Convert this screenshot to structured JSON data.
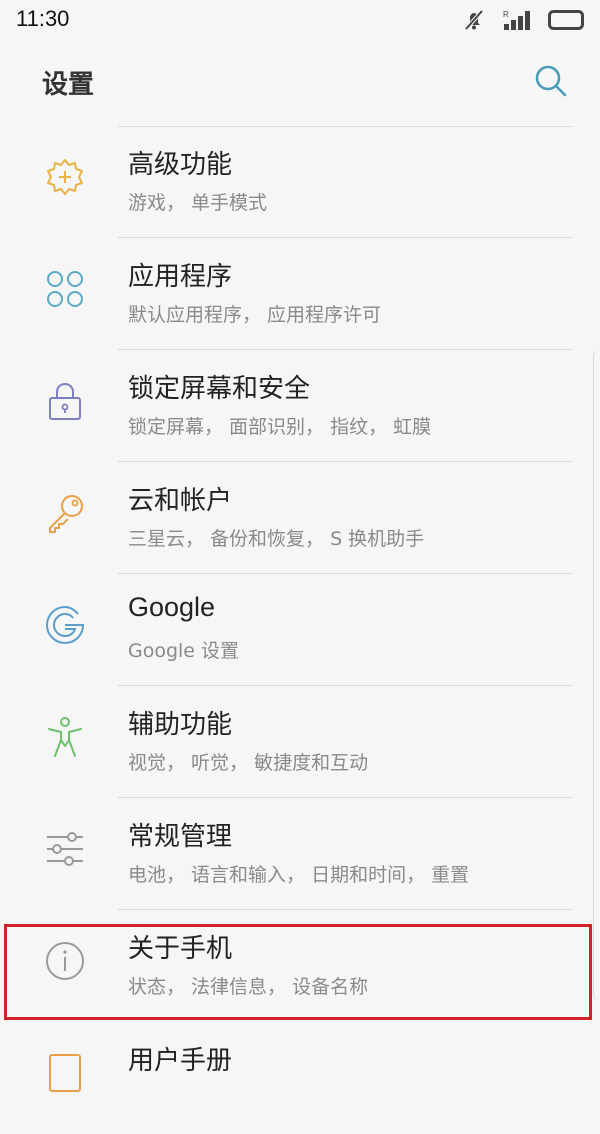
{
  "status_bar": {
    "time": "11:30"
  },
  "header": {
    "title": "设置"
  },
  "settings": [
    {
      "title": "高级功能",
      "subtitle": "游戏， 单手模式",
      "icon": "gear-plus-icon",
      "color": "#e8b347"
    },
    {
      "title": "应用程序",
      "subtitle": "默认应用程序， 应用程序许可",
      "icon": "apps-grid-icon",
      "color": "#5aa9c8"
    },
    {
      "title": "锁定屏幕和安全",
      "subtitle": "锁定屏幕， 面部识别， 指纹， 虹膜",
      "icon": "lock-icon",
      "color": "#7c7fbf"
    },
    {
      "title": "云和帐户",
      "subtitle": "三星云， 备份和恢复， S 换机助手",
      "icon": "key-icon",
      "color": "#e8a04a"
    },
    {
      "title": "Google",
      "subtitle": "Google 设置",
      "icon": "google-icon",
      "color": "#5b9ec9"
    },
    {
      "title": "辅助功能",
      "subtitle": "视觉， 听觉， 敏捷度和互动",
      "icon": "accessibility-icon",
      "color": "#6cbf6c"
    },
    {
      "title": "常规管理",
      "subtitle": "电池， 语言和输入， 日期和时间， 重置",
      "icon": "sliders-icon",
      "color": "#9a9a9a"
    },
    {
      "title": "关于手机",
      "subtitle": "状态， 法律信息， 设备名称",
      "icon": "info-icon",
      "color": "#9a9a9a"
    },
    {
      "title": "用户手册",
      "subtitle": "",
      "icon": "manual-icon",
      "color": "#e8a04a"
    }
  ],
  "highlight": {
    "target": "关于手机",
    "color": "#d0232a"
  }
}
